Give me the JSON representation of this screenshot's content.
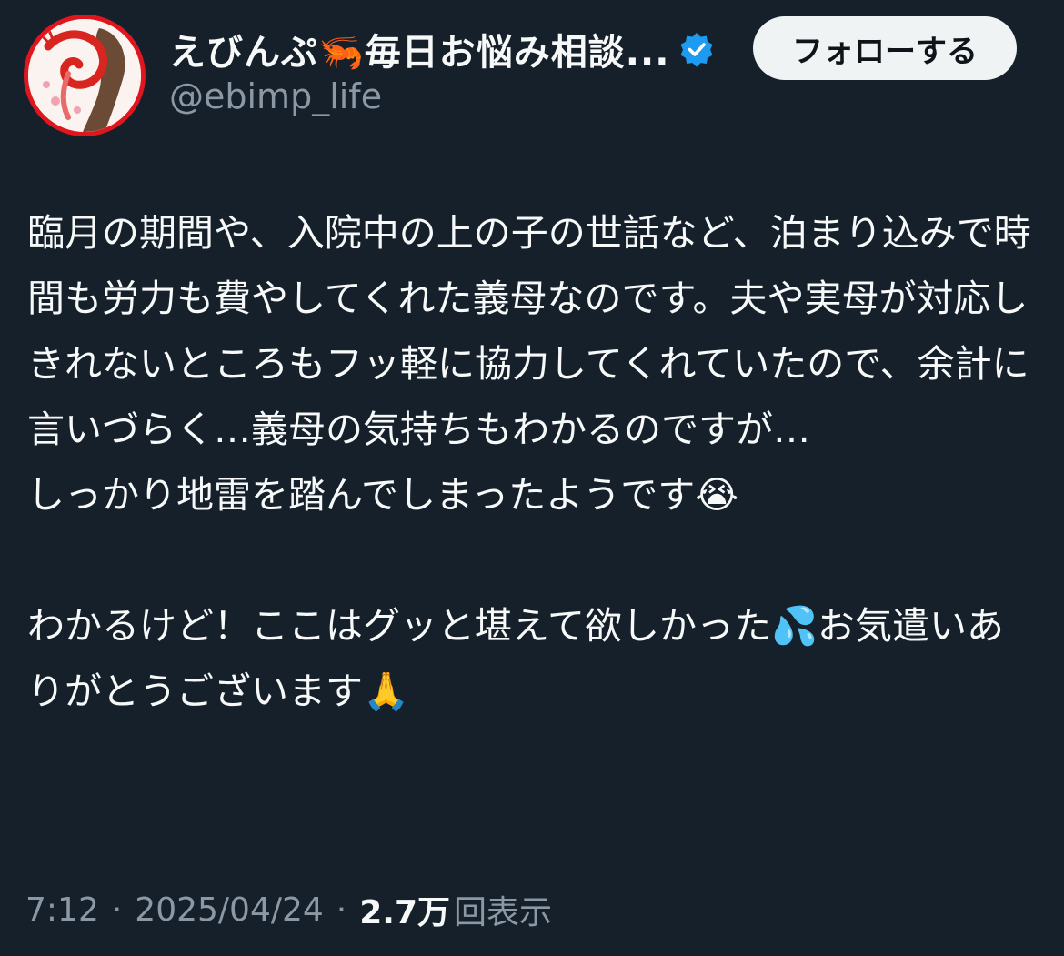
{
  "author": {
    "display_name": "えびんぷ🦐毎日お悩み相談...",
    "handle": "@ebimp_life",
    "verified_icon": "verified-badge-icon",
    "avatar": "avatar-shrimp-illustration"
  },
  "follow_button_label": "フォローする",
  "tweet": {
    "paragraphs": [
      "臨月の期間や、入院中の上の子の世話など、泊まり込みで時間も労力も費やしてくれた義母なのです。夫や実母が対応しきれないところもフッ軽に協力してくれていたので、余計に言いづらく…義母の気持ちもわかるのですが…",
      "しっかり地雷を踏んでしまったようです😭",
      "",
      "わかるけど！ここはグッと堪えて欲しかった💦お気遣いありがとうございます🙏"
    ]
  },
  "meta": {
    "time": "7:12",
    "separator": "·",
    "date": "2025/04/24",
    "views_count": "2.7万",
    "views_label": "回表示"
  },
  "colors": {
    "background": "#15202b",
    "text": "#f7f9f9",
    "secondary_text": "#8b98a5",
    "verified": "#1d9bf0",
    "follow_button_bg": "#eff3f4",
    "avatar_border": "#e0161f"
  }
}
